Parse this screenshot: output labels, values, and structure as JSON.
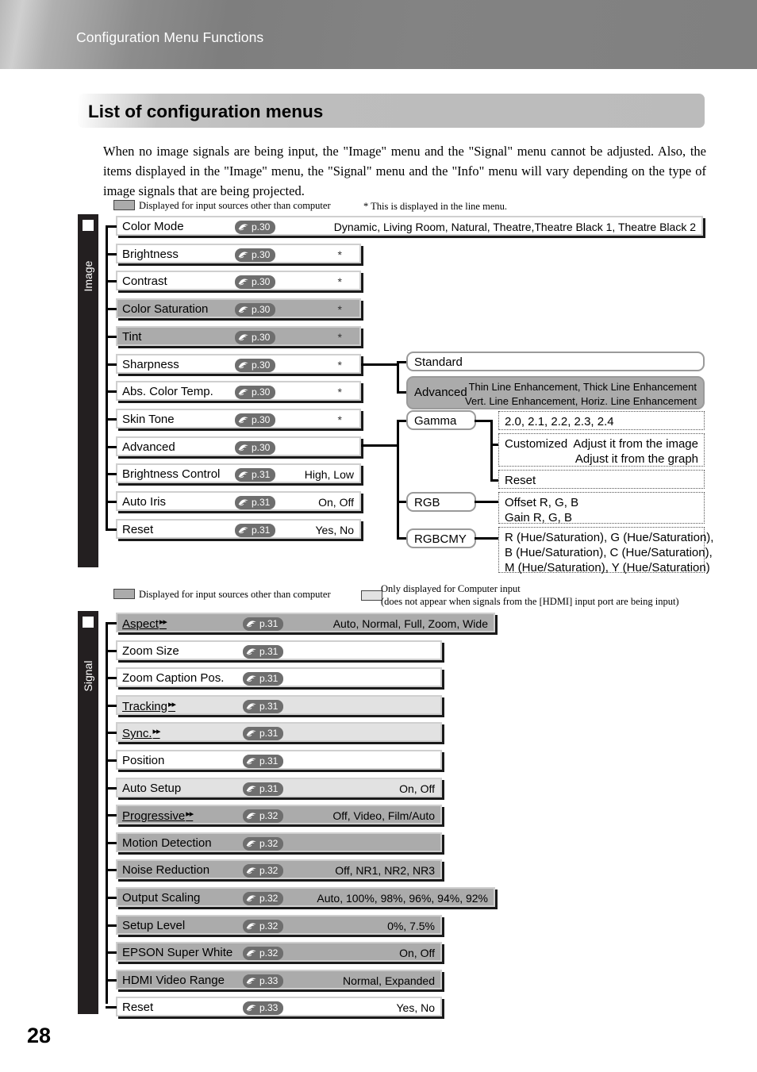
{
  "header": {
    "breadcrumb": "Configuration Menu Functions"
  },
  "title": "List of configuration menus",
  "intro": "When no image signals are being input, the \"Image\" menu and the \"Signal\" menu cannot be adjusted. Also, the items displayed in the \"Image\" menu, the \"Signal\" menu and the \"Info\" menu will vary depending on the type of image signals that are being projected.",
  "legend_image": {
    "gray_text": "Displayed for input sources other than computer",
    "star_note": "* This is displayed in the line menu."
  },
  "legend_signal": {
    "gray_text": "Displayed for input sources other than computer",
    "light_line1": "Only displayed for Computer input",
    "light_line2": "(does not appear when signals from the [HDMI] input port are being input)"
  },
  "sections": {
    "image": {
      "label": "Image"
    },
    "signal": {
      "label": "Signal"
    }
  },
  "image_rows": [
    {
      "label": "Color Mode",
      "page": "p.30",
      "values": "Dynamic, Living Room, Natural, Theatre,Theatre Black 1, Theatre Black 2",
      "star": ""
    },
    {
      "label": "Brightness",
      "page": "p.30",
      "values": "",
      "star": "*"
    },
    {
      "label": "Contrast",
      "page": "p.30",
      "values": "",
      "star": "*"
    },
    {
      "label": "Color Saturation",
      "page": "p.30",
      "values": "",
      "star": "*"
    },
    {
      "label": "Tint",
      "page": "p.30",
      "values": "",
      "star": "*"
    },
    {
      "label": "Sharpness",
      "page": "p.30",
      "values": "",
      "star": "*"
    },
    {
      "label": "Abs. Color Temp.",
      "page": "p.30",
      "values": "",
      "star": "*"
    },
    {
      "label": "Skin Tone",
      "page": "p.30",
      "values": "",
      "star": "*"
    },
    {
      "label": "Advanced",
      "page": "p.30",
      "values": "",
      "star": ""
    },
    {
      "label": "Brightness Control",
      "page": "p.31",
      "values": "High, Low",
      "star": ""
    },
    {
      "label": "Auto Iris",
      "page": "p.31",
      "values": "On, Off",
      "star": ""
    },
    {
      "label": "Reset",
      "page": "p.31",
      "values": "Yes, No",
      "star": ""
    }
  ],
  "sharpness_branch": {
    "standard": "Standard",
    "advanced": "Advanced",
    "advanced_sub1": "Thin Line Enhancement, Thick Line Enhancement",
    "advanced_sub2": "Vert. Line Enhancement, Horiz. Line Enhancement"
  },
  "advanced_branch": {
    "gamma": "Gamma",
    "gamma_values": "2.0, 2.1, 2.2, 2.3, 2.4",
    "gamma_customized": "Customized",
    "gamma_custom_1": "Adjust it from the image",
    "gamma_custom_2": "Adjust it from the graph",
    "gamma_reset": "Reset",
    "rgb": "RGB",
    "rgb_1": "Offset R, G, B",
    "rgb_2": "Gain R, G, B",
    "rgbcmy": "RGBCMY",
    "rgbcmy_1": "R (Hue/Saturation), G (Hue/Saturation),",
    "rgbcmy_2": "B (Hue/Saturation), C (Hue/Saturation),",
    "rgbcmy_3": "M (Hue/Saturation), Y (Hue/Saturation)"
  },
  "signal_rows": [
    {
      "label": "Aspect",
      "page": "p.31",
      "values": "Auto, Normal, Full, Zoom, Wide",
      "arrow": true,
      "shade": "g2",
      "wide": true
    },
    {
      "label": "Zoom Size",
      "page": "p.31",
      "values": "",
      "arrow": false,
      "shade": "",
      "wide": false
    },
    {
      "label": "Zoom Caption Pos.",
      "page": "p.31",
      "values": "",
      "arrow": false,
      "shade": "",
      "wide": false
    },
    {
      "label": "Tracking",
      "page": "p.31",
      "values": "",
      "arrow": true,
      "shade": "g1",
      "wide": false
    },
    {
      "label": "Sync.",
      "page": "p.31",
      "values": "",
      "arrow": true,
      "shade": "g1",
      "wide": false
    },
    {
      "label": "Position",
      "page": "p.31",
      "values": "",
      "arrow": false,
      "shade": "",
      "wide": false
    },
    {
      "label": "Auto Setup",
      "page": "p.31",
      "values": "On, Off",
      "arrow": false,
      "shade": "g1",
      "wide": false
    },
    {
      "label": "Progressive",
      "page": "p.32",
      "values": "Off, Video, Film/Auto",
      "arrow": true,
      "shade": "g2",
      "wide": false
    },
    {
      "label": "Motion Detection",
      "page": "p.32",
      "values": "",
      "arrow": false,
      "shade": "g2",
      "wide": false
    },
    {
      "label": "Noise Reduction",
      "page": "p.32",
      "values": "Off, NR1, NR2, NR3",
      "arrow": false,
      "shade": "g2",
      "wide": false
    },
    {
      "label": "Output Scaling",
      "page": "p.32",
      "values": "Auto, 100%, 98%, 96%, 94%, 92%",
      "arrow": false,
      "shade": "g2",
      "wide": true
    },
    {
      "label": "Setup Level",
      "page": "p.32",
      "values": "0%, 7.5%",
      "arrow": false,
      "shade": "g2",
      "wide": false
    },
    {
      "label": "EPSON Super White",
      "page": "p.32",
      "values": "On, Off",
      "arrow": false,
      "shade": "g2",
      "wide": false
    },
    {
      "label": "HDMI Video Range",
      "page": "p.33",
      "values": "Normal, Expanded",
      "arrow": false,
      "shade": "g2",
      "wide": false
    },
    {
      "label": "Reset",
      "page": "p.33",
      "values": "Yes, No",
      "arrow": false,
      "shade": "",
      "wide": false
    }
  ],
  "page_number": "28",
  "colors": {
    "gray_dark": "#ababab",
    "gray_light": "#e2e2e2",
    "badge": "#6e6e6e",
    "tab": "#231f20"
  }
}
